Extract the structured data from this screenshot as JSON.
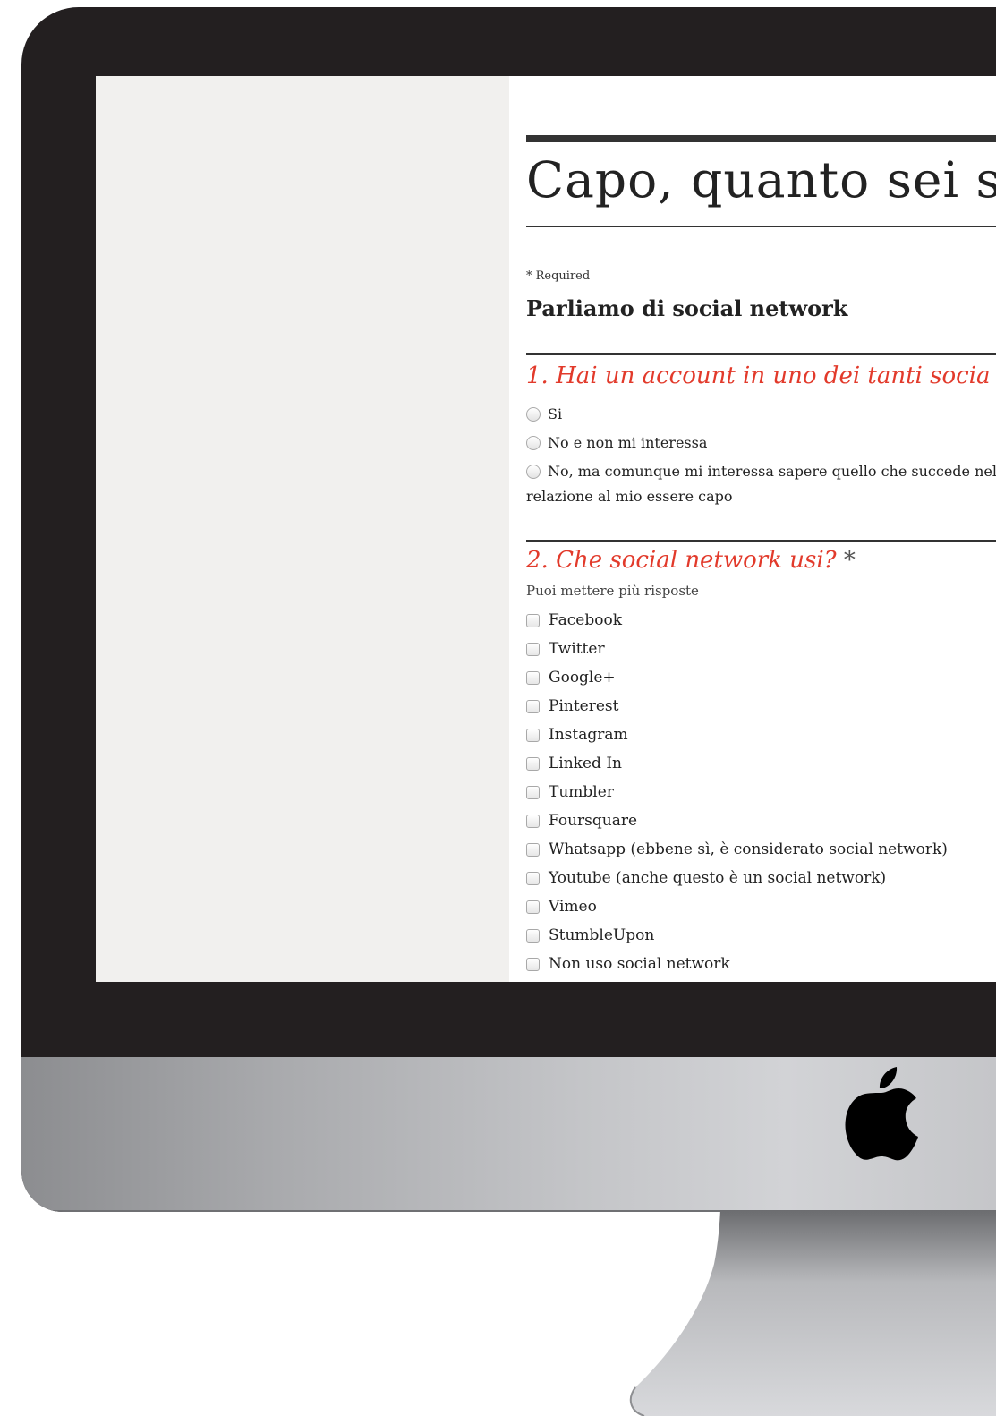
{
  "form": {
    "title": "Capo, quanto sei s",
    "required_note": "* Required",
    "section_title": "Parliamo di social network"
  },
  "questions": [
    {
      "title": "1. Hai un account in uno dei tanti socia",
      "options": [
        "Si",
        "No e non mi interessa",
        "No, ma comunque mi interessa sapere quello che succede nel"
      ],
      "option_continuation": "relazione al mio essere capo"
    },
    {
      "title": "2. Che social network usi?",
      "required_mark": "*",
      "help": "Puoi mettere più risposte",
      "options": [
        "Facebook",
        "Twitter",
        "Google+",
        "Pinterest",
        "Instagram",
        "Linked In",
        "Tumbler",
        "Foursquare",
        "Whatsapp (ebbene sì, è considerato social network)",
        "Youtube (anche questo è un social network)",
        "Vimeo",
        "StumbleUpon",
        "Non uso social network"
      ]
    }
  ],
  "device": {
    "logo": "apple-logo-icon"
  }
}
